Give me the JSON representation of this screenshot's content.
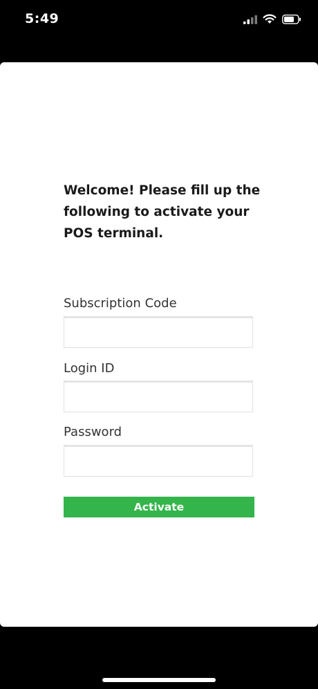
{
  "status_bar": {
    "time": "5:49",
    "icons": [
      "cellular-signal-icon",
      "wifi-icon",
      "battery-icon"
    ],
    "color": "#ffffff"
  },
  "form": {
    "welcome_text": "Welcome! Please fill up the following to activate your POS terminal.",
    "fields": [
      {
        "label": "Subscription Code",
        "value": "",
        "placeholder": ""
      },
      {
        "label": "Login ID",
        "value": "",
        "placeholder": ""
      },
      {
        "label": "Password",
        "value": "",
        "placeholder": ""
      }
    ],
    "activate_label": "Activate"
  },
  "colors": {
    "background": "#000000",
    "card": "#ffffff",
    "accent": "#34b54b",
    "text": "#1a1a1a"
  }
}
